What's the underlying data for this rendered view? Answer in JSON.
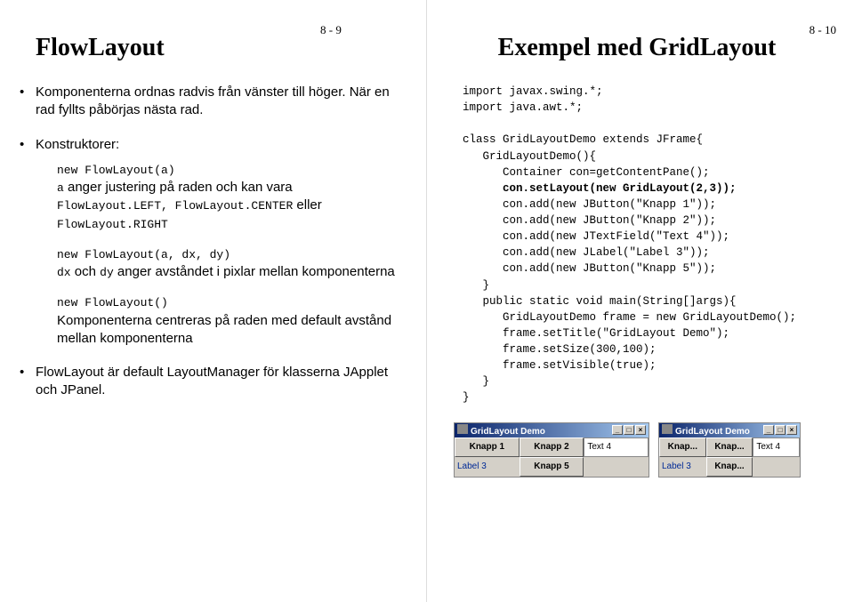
{
  "left": {
    "pageno": "8 - 9",
    "title": "FlowLayout",
    "bullet1": "Komponenterna ordnas radvis från vänster till höger. När en rad fyllts påbörjas nästa rad.",
    "bullet2_label": "Konstruktorer:",
    "c1_code": "new FlowLayout(a)",
    "c1_text_a": "a",
    "c1_text_b": " anger justering på raden och kan vara ",
    "c1_code2": "FlowLayout.LEFT, FlowLayout.CENTER",
    "c1_text_c": " eller ",
    "c1_code3": "FlowLayout.RIGHT",
    "c2_code": "new FlowLayout(a, dx, dy)",
    "c2_text_a": "dx",
    "c2_text_b": " och ",
    "c2_text_c": "dy",
    "c2_text_d": " anger avståndet i pixlar mellan komponenterna",
    "c3_code": "new FlowLayout()",
    "c3_text": "Komponenterna centreras på raden med default avstånd mellan komponenterna",
    "bullet3": "FlowLayout är default LayoutManager för klasserna JApplet och JPanel."
  },
  "right": {
    "pageno": "8 - 10",
    "title": "Exempel med GridLayout",
    "code": "import javax.swing.*;\nimport java.awt.*;\n\nclass GridLayoutDemo extends JFrame{\n   GridLayoutDemo(){\n      Container con=getContentPane();\n      con.setLayout(new GridLayout(2,3));\n      con.add(new JButton(\"Knapp 1\"));\n      con.add(new JButton(\"Knapp 2\"));\n      con.add(new JTextField(\"Text 4\"));\n      con.add(new JLabel(\"Label 3\"));\n      con.add(new JButton(\"Knapp 5\"));\n   }\n   public static void main(String[]args){\n      GridLayoutDemo frame = new GridLayoutDemo();\n      frame.setTitle(\"GridLayout Demo\");\n      frame.setSize(300,100);\n      frame.setVisible(true);\n   }\n}",
    "win1": {
      "title": "GridLayout Demo",
      "cells": [
        "Knapp 1",
        "Knapp 2",
        "Text 4",
        "Label 3",
        "Knapp 5",
        ""
      ]
    },
    "win2": {
      "title": "GridLayout Demo",
      "cells": [
        "Knap...",
        "Knap...",
        "Text 4",
        "Label 3",
        "Knap...",
        ""
      ]
    }
  }
}
